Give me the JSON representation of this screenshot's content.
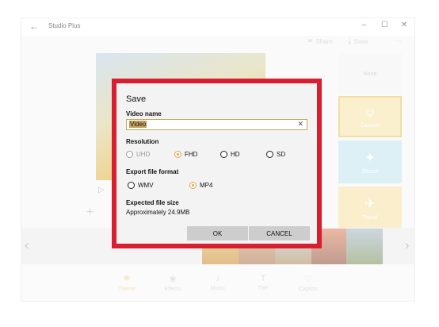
{
  "window": {
    "title": "Studio Plus",
    "back_icon": "←",
    "minimize_icon": "–",
    "maximize_icon": "☐",
    "close_icon": "✕"
  },
  "toolbar": {
    "share_label": "Share",
    "save_label": "Save",
    "more_label": "···"
  },
  "filters": {
    "none_label": "None",
    "cartoon_label": "Cartoon",
    "sketch_label": "Sketch",
    "travel_label": "Travel"
  },
  "bottom_tabs": [
    {
      "label": "Theme",
      "icon": "theme-icon",
      "active": true
    },
    {
      "label": "Effects",
      "icon": "effects-icon",
      "active": false
    },
    {
      "label": "Music",
      "icon": "music-icon",
      "active": false
    },
    {
      "label": "Title",
      "icon": "title-icon",
      "active": false
    },
    {
      "label": "Caption",
      "icon": "caption-icon",
      "active": false
    }
  ],
  "dialog": {
    "title": "Save",
    "video_name_label": "Video name",
    "video_name_value": "Video",
    "resolution_label": "Resolution",
    "resolution_options": [
      "UHD",
      "FHD",
      "HD",
      "SD"
    ],
    "resolution_selected": "FHD",
    "format_label": "Export file format",
    "format_options": [
      "WMV",
      "MP4"
    ],
    "format_selected": "MP4",
    "size_label": "Expected file size",
    "size_value": "Approximately 24.9MB",
    "ok_label": "OK",
    "cancel_label": "CANCEL"
  },
  "colors": {
    "accent": "#e0a34a",
    "highlight_frame": "#d71f2f"
  }
}
